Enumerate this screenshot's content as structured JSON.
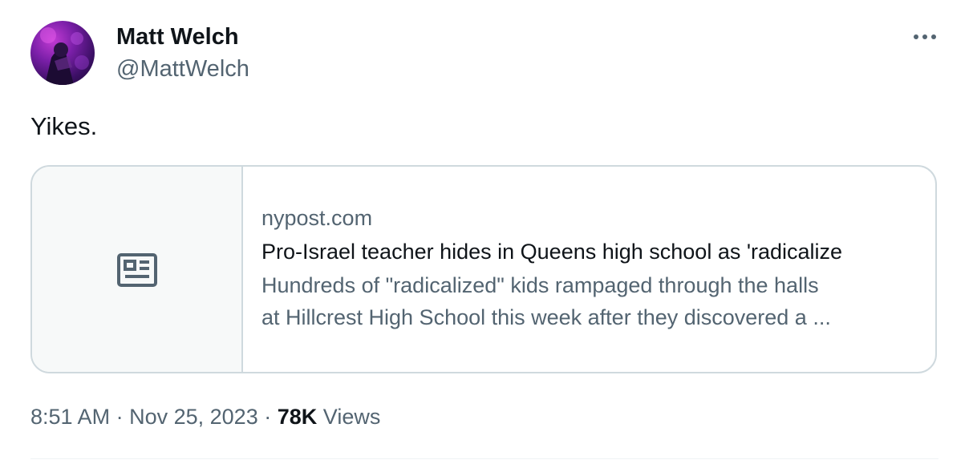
{
  "author": {
    "name": "Matt Welch",
    "handle": "@MattWelch"
  },
  "tweet": {
    "text": "Yikes."
  },
  "card": {
    "domain": "nypost.com",
    "title": "Pro-Israel teacher hides in Queens high school as 'radicalize",
    "description_line1": "Hundreds of \"radicalized\" kids rampaged through the halls",
    "description_line2": "at Hillcrest High School this week after they discovered a ...",
    "media_icon": "news-article-icon"
  },
  "meta": {
    "time": "8:51 AM",
    "separator": "·",
    "date": "Nov 25, 2023",
    "views_count": "78K",
    "views_label": "Views"
  },
  "icons": {
    "more": "more-horizontal-icon"
  },
  "colors": {
    "primary_text": "#0f1419",
    "secondary_text": "#536471",
    "border": "#cfd9de",
    "card_media_bg": "#f7f9f9"
  }
}
